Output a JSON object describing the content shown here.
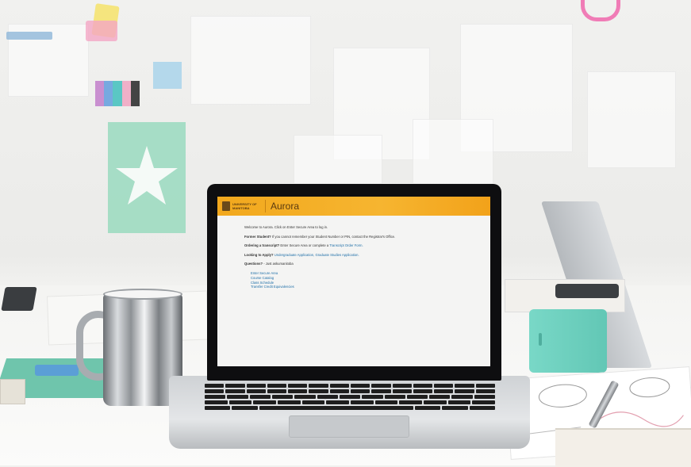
{
  "scene": {
    "colors": {
      "banner": "#f2a81d",
      "mint_post_it": "#9fdcc2",
      "speaker_teal": "#79d8c7",
      "mug_metal": "#b8bcc0"
    },
    "icons": [
      "coffee-mug-icon",
      "bluetooth-speaker-icon",
      "pen-icon",
      "star-icon"
    ]
  },
  "laptop_screen": {
    "logo_text": "UNIVERSITY OF MANITOBA",
    "app_title": "Aurora",
    "welcome_text": "Welcome to Aurora. Click on Enter Secure Area to log in.",
    "former_student_label": "Former Student?",
    "former_student_text": "If you cannot remember your Student Number or PIN, contact the Registrar's Office.",
    "ordering_label": "Ordering a transcript?",
    "ordering_text": "Enter Secure Area or complete a",
    "ordering_link": "Transcript Order Form.",
    "apply_label": "Looking to Apply?",
    "apply_link_1": "Undergraduate Application,",
    "apply_link_2": "Graduate Studies Application.",
    "questions_label": "Questions?",
    "questions_text": "- Just askumanitoba",
    "menu_links": [
      "Enter Secure Area",
      "Course Catalog",
      "Class Schedule",
      "Transfer Credit Equivalencies"
    ]
  }
}
